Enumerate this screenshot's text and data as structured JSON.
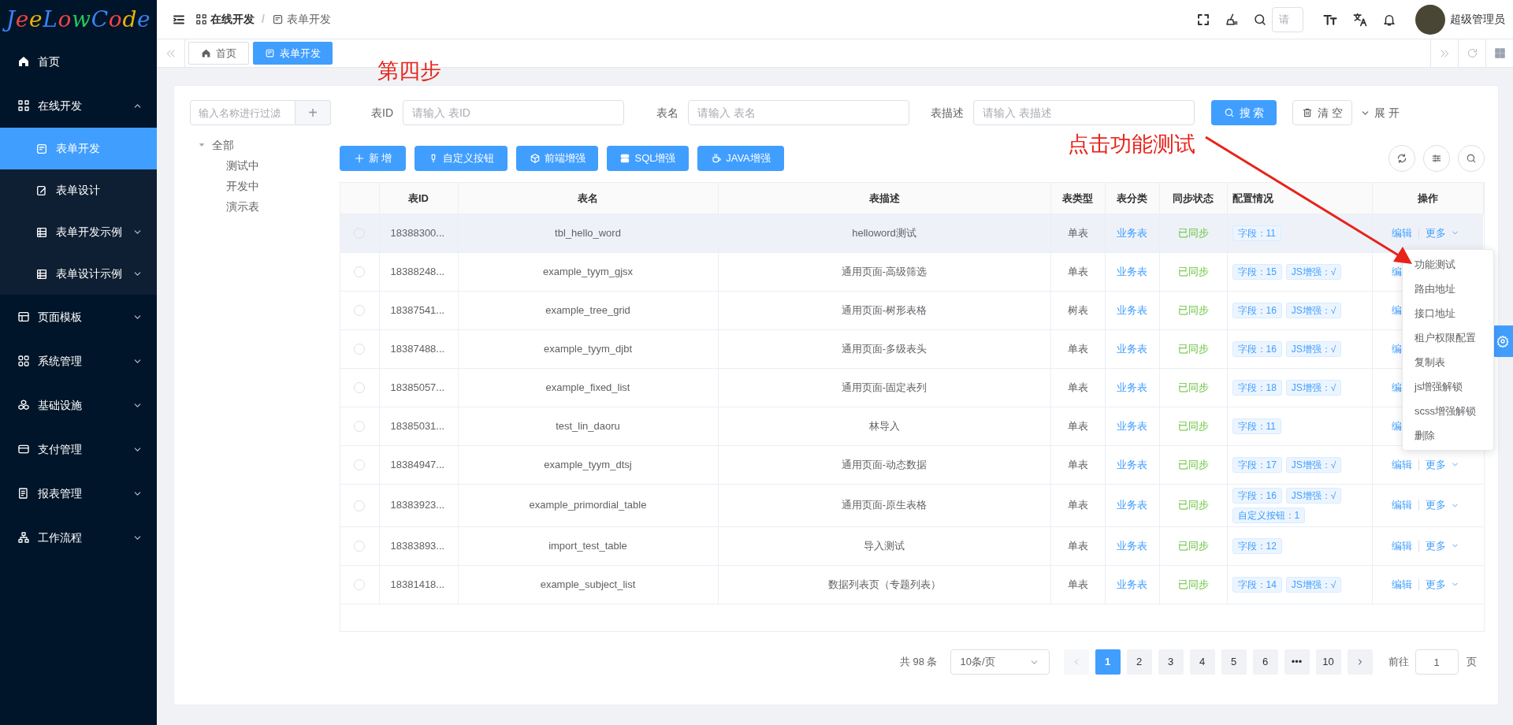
{
  "sidebar": {
    "logo": "JeeLowCode",
    "items": [
      {
        "kind": "link",
        "label": "首页",
        "selected": false
      },
      {
        "kind": "group",
        "label": "在线开发",
        "selected": false,
        "expanded": true,
        "children": [
          {
            "kind": "link",
            "label": "表单开发",
            "selected": true
          },
          {
            "kind": "link",
            "label": "表单设计",
            "selected": false
          },
          {
            "kind": "group",
            "label": "表单开发示例",
            "selected": false,
            "expanded": false
          },
          {
            "kind": "group",
            "label": "表单设计示例",
            "selected": false,
            "expanded": false
          }
        ]
      },
      {
        "kind": "group",
        "label": "页面模板",
        "selected": false,
        "expanded": false
      },
      {
        "kind": "group",
        "label": "系统管理",
        "selected": false,
        "expanded": false
      },
      {
        "kind": "group",
        "label": "基础设施",
        "selected": false,
        "expanded": false
      },
      {
        "kind": "group",
        "label": "支付管理",
        "selected": false,
        "expanded": false
      },
      {
        "kind": "group",
        "label": "报表管理",
        "selected": false,
        "expanded": false
      },
      {
        "kind": "group",
        "label": "工作流程",
        "selected": false,
        "expanded": false
      }
    ]
  },
  "header": {
    "breadcrumb": [
      {
        "label": "在线开发"
      },
      {
        "label": "表单开发"
      }
    ],
    "separator": "/",
    "search": {
      "placeholder": "请"
    },
    "user_name": "超级管理员"
  },
  "tabs": [
    {
      "label": "首页",
      "selected": false
    },
    {
      "label": "表单开发",
      "selected": true
    }
  ],
  "annotations": [
    {
      "text": "第四步"
    },
    {
      "text": "点击功能测试"
    }
  ],
  "tree_filter": {
    "placeholder": "输入名称进行过滤",
    "add_button": "+"
  },
  "tree": [
    {
      "label": "全部",
      "expanded": true,
      "children": [
        {
          "label": "测试中"
        },
        {
          "label": "开发中"
        },
        {
          "label": "演示表"
        }
      ]
    }
  ],
  "search_form": {
    "fields": [
      {
        "label": "表ID",
        "placeholder": "请输入 表ID"
      },
      {
        "label": "表名",
        "placeholder": "请输入 表名"
      },
      {
        "label": "表描述",
        "placeholder": "请输入 表描述"
      }
    ],
    "search_button": "搜 索",
    "clear_button": "清 空",
    "expand_toggle": "展 开"
  },
  "toolbar": [
    "新 增",
    "自定义按钮",
    "前端增强",
    "SQL增强",
    "JAVA增强"
  ],
  "table": {
    "columns": [
      "表ID",
      "表名",
      "表描述",
      "表类型",
      "表分类",
      "同步状态",
      "配置情况",
      "操作"
    ],
    "rows": [
      {
        "selected": false,
        "highlighted": true,
        "id": "18388300...",
        "name": "tbl_hello_word",
        "description": "helloword测试",
        "type": "单表",
        "category": "业务表",
        "sync": "已同步",
        "tags": [
          "字段：11"
        ],
        "edit": "编辑",
        "more": "更多"
      },
      {
        "selected": false,
        "highlighted": false,
        "id": "18388248...",
        "name": "example_tyym_gjsx",
        "description": "通用页面-高级筛选",
        "type": "单表",
        "category": "业务表",
        "sync": "已同步",
        "tags": [
          "字段：15",
          "JS增强：√"
        ],
        "edit": "编"
      },
      {
        "selected": false,
        "highlighted": false,
        "id": "18387541...",
        "name": "example_tree_grid",
        "description": "通用页面-树形表格",
        "type": "树表",
        "category": "业务表",
        "sync": "已同步",
        "tags": [
          "字段：16",
          "JS增强：√"
        ],
        "edit": "编"
      },
      {
        "selected": false,
        "highlighted": false,
        "id": "18387488...",
        "name": "example_tyym_djbt",
        "description": "通用页面-多级表头",
        "type": "单表",
        "category": "业务表",
        "sync": "已同步",
        "tags": [
          "字段：16",
          "JS增强：√"
        ],
        "edit": "编"
      },
      {
        "selected": false,
        "highlighted": false,
        "id": "18385057...",
        "name": "example_fixed_list",
        "description": "通用页面-固定表列",
        "type": "单表",
        "category": "业务表",
        "sync": "已同步",
        "tags": [
          "字段：18",
          "JS增强：√"
        ],
        "edit": "编"
      },
      {
        "selected": false,
        "highlighted": false,
        "id": "18385031...",
        "name": "test_lin_daoru",
        "description": "林导入",
        "type": "单表",
        "category": "业务表",
        "sync": "已同步",
        "tags": [
          "字段：11"
        ],
        "edit": "编"
      },
      {
        "selected": false,
        "highlighted": false,
        "id": "18384947...",
        "name": "example_tyym_dtsj",
        "description": "通用页面-动态数据",
        "type": "单表",
        "category": "业务表",
        "sync": "已同步",
        "tags": [
          "字段：17",
          "JS增强：√"
        ],
        "edit": "编辑",
        "more": "更多"
      },
      {
        "selected": false,
        "highlighted": false,
        "id": "18383923...",
        "name": "example_primordial_table",
        "description": "通用页面-原生表格",
        "type": "单表",
        "category": "业务表",
        "sync": "已同步",
        "tags": [
          "字段：16",
          "JS增强：√",
          "自定义按钮：1"
        ],
        "edit": "编辑",
        "more": "更多"
      },
      {
        "selected": false,
        "highlighted": false,
        "id": "18383893...",
        "name": "import_test_table",
        "description": "导入测试",
        "type": "单表",
        "category": "业务表",
        "sync": "已同步",
        "tags": [
          "字段：12"
        ],
        "edit": "编辑",
        "more": "更多"
      },
      {
        "selected": false,
        "highlighted": false,
        "id": "18381418...",
        "name": "example_subject_list",
        "description": "数据列表页（专题列表）",
        "type": "单表",
        "category": "业务表",
        "sync": "已同步",
        "tags": [
          "字段：14",
          "JS增强：√"
        ],
        "edit": "编辑",
        "more": "更多"
      }
    ]
  },
  "dropdown_menu": [
    "功能测试",
    "路由地址",
    "接口地址",
    "租户权限配置",
    "复制表",
    "js增强解锁",
    "scss增强解锁",
    "删除"
  ],
  "pagination": {
    "total": "共 98 条",
    "page_size": "10条/页",
    "prev_disabled": true,
    "pages": [
      {
        "label": "1",
        "selected": true
      },
      {
        "label": "2",
        "selected": false
      },
      {
        "label": "3",
        "selected": false
      },
      {
        "label": "4",
        "selected": false
      },
      {
        "label": "5",
        "selected": false
      },
      {
        "label": "6",
        "selected": false
      },
      {
        "label": "•••",
        "selected": false
      },
      {
        "label": "10",
        "selected": false
      }
    ],
    "goto_label": "前往",
    "goto_value": "1",
    "page_unit": "页"
  }
}
